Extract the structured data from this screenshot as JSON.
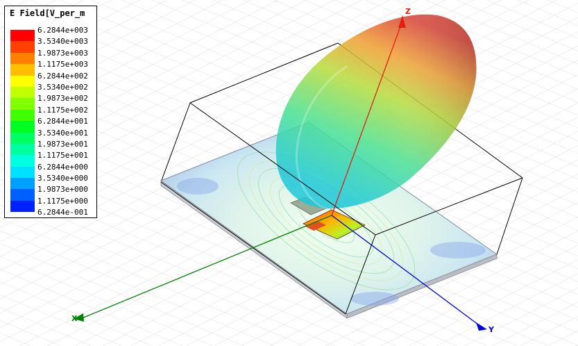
{
  "legend": {
    "title": "E Field[V_per_m",
    "entries": [
      {
        "value": "6.2844e+003",
        "color": "#ff0000"
      },
      {
        "value": "3.5340e+003",
        "color": "#ff4000"
      },
      {
        "value": "1.9873e+003",
        "color": "#ff8000"
      },
      {
        "value": "1.1175e+003",
        "color": "#ffbf00"
      },
      {
        "value": "6.2844e+002",
        "color": "#ffff00"
      },
      {
        "value": "3.5340e+002",
        "color": "#c0ff00"
      },
      {
        "value": "1.9873e+002",
        "color": "#80ff00"
      },
      {
        "value": "1.1175e+002",
        "color": "#40ff00"
      },
      {
        "value": "6.2844e+001",
        "color": "#00ff20"
      },
      {
        "value": "3.5340e+001",
        "color": "#00ff60"
      },
      {
        "value": "1.9873e+001",
        "color": "#00ffa0"
      },
      {
        "value": "1.1175e+001",
        "color": "#00ffe0"
      },
      {
        "value": "6.2844e+000",
        "color": "#00e0ff"
      },
      {
        "value": "3.5340e+000",
        "color": "#00a0ff"
      },
      {
        "value": "1.9873e+000",
        "color": "#0060ff"
      },
      {
        "value": "1.1175e+000",
        "color": "#0020ff"
      },
      {
        "value": "6.2844e-001",
        "color": ""
      }
    ]
  },
  "axes": {
    "z_label": "Z",
    "y_label": "Y",
    "x_label": "X",
    "z_color": "#e02010",
    "y_color": "#0000e0",
    "x_color": "#008000"
  }
}
